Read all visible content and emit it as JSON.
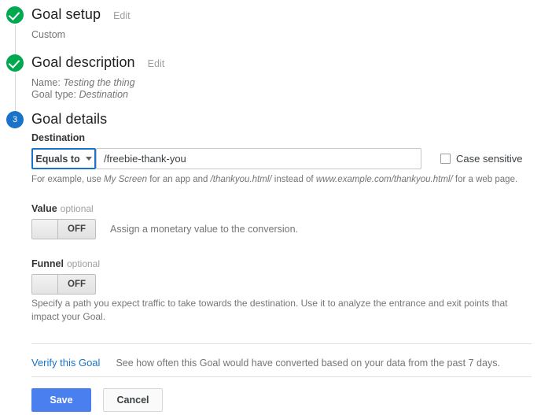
{
  "steps": [
    {
      "marker": "check-icon",
      "state": "done",
      "title": "Goal setup",
      "edit_label": "Edit",
      "summary": "Custom"
    },
    {
      "marker": "check-icon",
      "state": "done",
      "title": "Goal description",
      "edit_label": "Edit",
      "name_label": "Name:",
      "name_value": "Testing the thing",
      "type_label": "Goal type:",
      "type_value": "Destination"
    },
    {
      "marker": "3",
      "state": "active",
      "title": "Goal details"
    }
  ],
  "destination": {
    "label": "Destination",
    "match_type": "Equals to",
    "caret_icon": "chevron-down-icon",
    "url_value": "/freebie-thank-you",
    "url_placeholder": "",
    "case_sensitive_label": "Case sensitive",
    "case_sensitive_checked": false,
    "helper_prefix": "For example, use ",
    "helper_italic_1": "My Screen",
    "helper_mid_1": " for an app and ",
    "helper_italic_2": "/thankyou.html/",
    "helper_mid_2": " instead of ",
    "helper_italic_3": "www.example.com/thankyou.html/",
    "helper_suffix": " for a web page."
  },
  "value_section": {
    "label": "Value",
    "optional_label": "optional",
    "toggle_state": "OFF",
    "description": "Assign a monetary value to the conversion."
  },
  "funnel_section": {
    "label": "Funnel",
    "optional_label": "optional",
    "toggle_state": "OFF",
    "description": "Specify a path you expect traffic to take towards the destination. Use it to analyze the entrance and exit points that impact your Goal."
  },
  "verify": {
    "link_label": "Verify this Goal",
    "description": "See how often this Goal would have converted based on your data from the past 7 days."
  },
  "actions": {
    "save_label": "Save",
    "cancel_label": "Cancel"
  },
  "colors": {
    "done_green": "#00A94F",
    "active_blue": "#1A73C9",
    "primary_button": "#4A7FEF",
    "link_blue": "#1A73C9"
  }
}
